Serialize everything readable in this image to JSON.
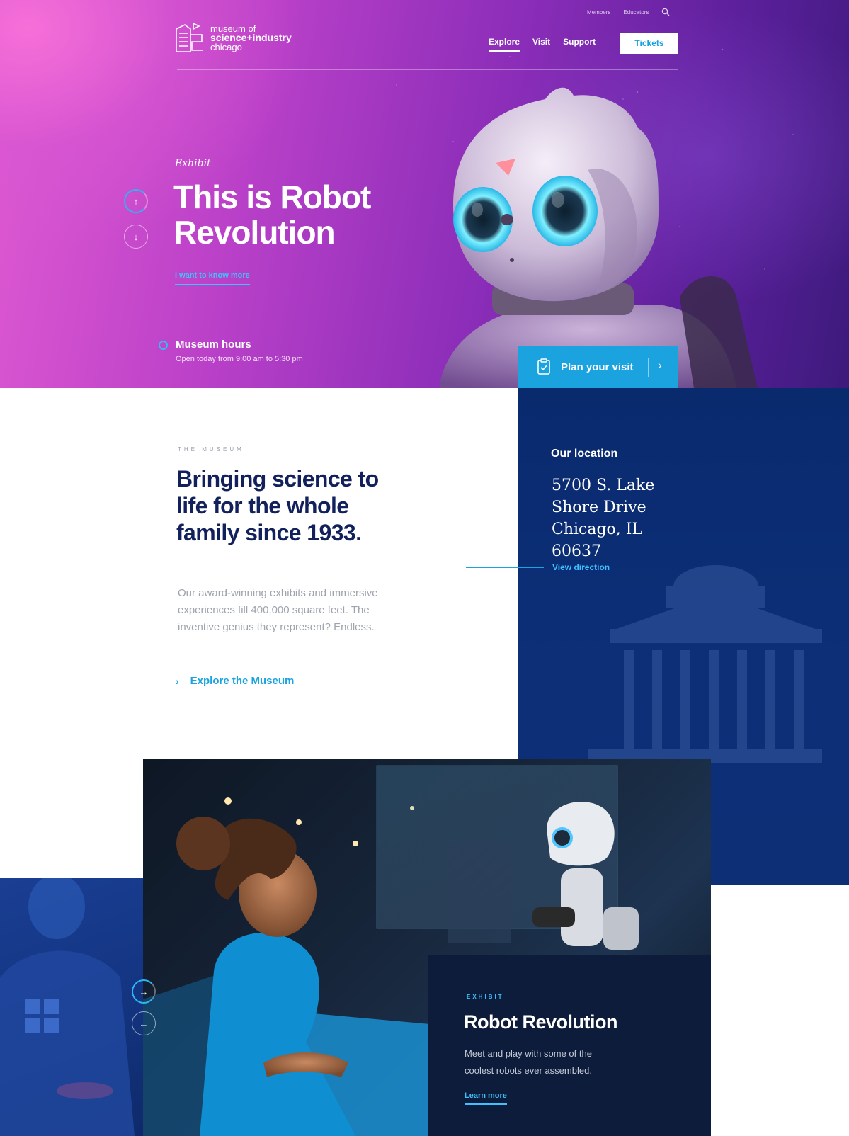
{
  "header": {
    "logo": {
      "line1": "museum of",
      "line2": "science+industry",
      "line3": "chicago"
    },
    "utility": {
      "members": "Members",
      "separator": "|",
      "educators": "Educators"
    },
    "nav": [
      {
        "label": "Explore",
        "active": true
      },
      {
        "label": "Visit",
        "active": false
      },
      {
        "label": "Support",
        "active": false
      }
    ],
    "tickets_label": "Tickets"
  },
  "hero": {
    "eyebrow": "Exhibit",
    "title": "This is Robot Revolution",
    "cta_label": "I want to know more",
    "slider_up": "↑",
    "slider_down": "↓",
    "hours_title": "Museum hours",
    "hours_text": "Open today from 9:00 am to 5:30 pm",
    "plan_label": "Plan your visit",
    "plan_chevron": "›"
  },
  "museum": {
    "eyebrow": "THE MUSEUM",
    "title": "Bringing science to life for the whole family since 1933.",
    "body": "Our award-winning exhibits and immersive experiences fill 400,000 square feet. The inventive genius they represent? Endless.",
    "explore_label": "Explore the Museum",
    "explore_chevron": "›"
  },
  "location": {
    "title": "Our location",
    "address": "5700 S. Lake Shore Drive Chicago, IL 60637",
    "view_direction": "View direction"
  },
  "exhibit_card": {
    "eyebrow": "EXHIBIT",
    "title": "Robot Revolution",
    "body": "Meet and play with some of the coolest robots ever assembled.",
    "link_label": "Learn more",
    "next_arrow": "→",
    "prev_arrow": "←"
  },
  "colors": {
    "accent": "#1ba3df",
    "navy": "#12215c",
    "location_panel": "#0c2f78",
    "card": "#0d1c3a"
  },
  "icons": [
    "logo-mark",
    "search-icon",
    "clock-icon",
    "clipboard-icon",
    "chevron-right-icon",
    "arrow-up-icon",
    "arrow-down-icon",
    "arrow-right-icon",
    "arrow-left-icon"
  ]
}
